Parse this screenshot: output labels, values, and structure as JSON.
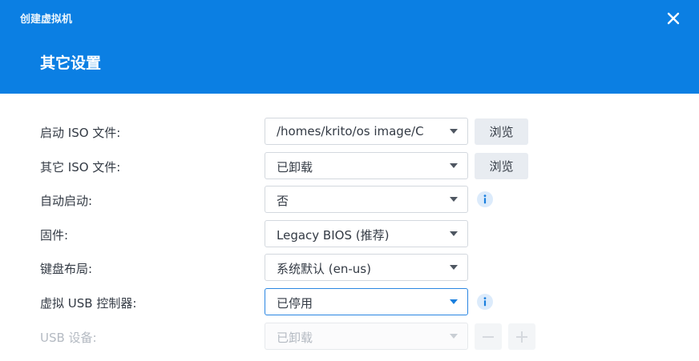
{
  "window": {
    "title": "创建虚拟机"
  },
  "page": {
    "title": "其它设置"
  },
  "form": {
    "rows": [
      {
        "label": "启动 ISO 文件:",
        "value": "/homes/krito/os image/C",
        "button": "浏览"
      },
      {
        "label": "其它 ISO 文件:",
        "value": "已卸载",
        "button": "浏览"
      },
      {
        "label": "自动启动:",
        "value": "否",
        "info_icon": "info-icon"
      },
      {
        "label": "固件:",
        "value": "Legacy BIOS (推荐)"
      },
      {
        "label": "键盘布局:",
        "value": "系统默认 (en-us)"
      },
      {
        "label": "虚拟 USB 控制器:",
        "value": "已停用",
        "info_icon": "info-icon",
        "focused": true
      },
      {
        "label": "USB 设备:",
        "value": "已卸载",
        "disabled": true
      }
    ]
  },
  "colors": {
    "header": "#0b7fe3",
    "accent": "#1a7fde",
    "button_bg": "#e8ecf1",
    "disabled_text": "#b4bac2"
  },
  "icons": {
    "close": "close-icon",
    "caret": "chevron-down-icon",
    "info": "info-icon",
    "remove": "minus-icon",
    "add": "plus-icon"
  }
}
